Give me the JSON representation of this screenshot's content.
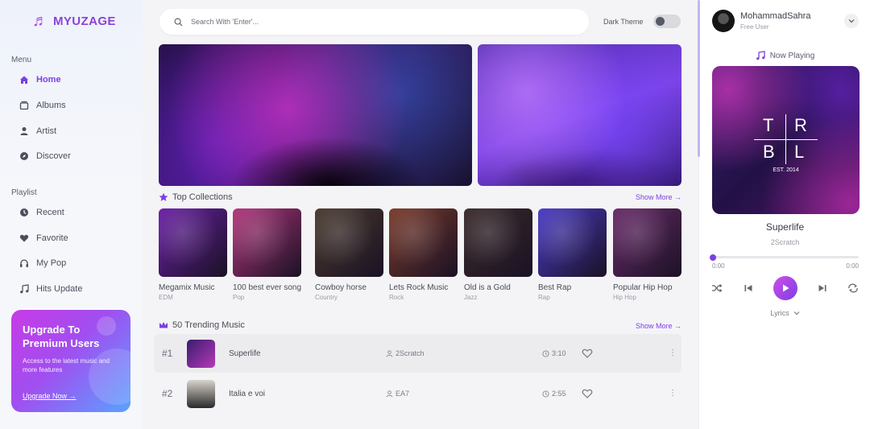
{
  "brand": {
    "name": "MYUZAGE"
  },
  "menu": {
    "label": "Menu",
    "items": [
      {
        "label": "Home",
        "icon": "home-icon",
        "active": true
      },
      {
        "label": "Albums",
        "icon": "album-icon"
      },
      {
        "label": "Artist",
        "icon": "user-icon"
      },
      {
        "label": "Discover",
        "icon": "compass-icon"
      }
    ]
  },
  "playlist": {
    "label": "Playlist",
    "items": [
      {
        "label": "Recent",
        "icon": "clock-icon"
      },
      {
        "label": "Favorite",
        "icon": "heart-icon"
      },
      {
        "label": "My Pop",
        "icon": "headphones-icon"
      },
      {
        "label": "Hits Update",
        "icon": "music-note-icon"
      }
    ]
  },
  "promo": {
    "title": "Upgrade To Premium Users",
    "subtitle": "Access to the latest music and more features",
    "link": "Upgrade Now →"
  },
  "search": {
    "placeholder": "Search With 'Enter'..."
  },
  "theme": {
    "label": "Dark Theme",
    "enabled": false
  },
  "collections": {
    "title": "Top Collections",
    "show_more": "Show More →",
    "items": [
      {
        "name": "Megamix Music",
        "genre": "EDM",
        "color": "#6a1fa6"
      },
      {
        "name": "100 best ever song",
        "genre": "Pop",
        "color": "#b2357d"
      },
      {
        "name": "Cowboy horse",
        "genre": "Country",
        "color": "#4a3a2e"
      },
      {
        "name": "Lets Rock Music",
        "genre": "Rock",
        "color": "#7a3a2a"
      },
      {
        "name": "Old is a Gold",
        "genre": "Jazz",
        "color": "#3a2a2a"
      },
      {
        "name": "Best Rap",
        "genre": "Rap",
        "color": "#4a3ac8"
      },
      {
        "name": "Popular Hip Hop",
        "genre": "Hip Hop",
        "color": "#6a2a6a"
      }
    ]
  },
  "trending": {
    "title": "50 Trending Music",
    "show_more": "Show More →",
    "tracks": [
      {
        "rank": "#1",
        "title": "Superlife",
        "artist": "2Scratch",
        "duration": "3:10"
      },
      {
        "rank": "#2",
        "title": "Italia e voi",
        "artist": "EA7",
        "duration": "2:55"
      }
    ]
  },
  "user": {
    "name": "MohammadSahra",
    "type": "Free User"
  },
  "player": {
    "label": "Now Playing",
    "title": "Superlife",
    "artist": "2Scratch",
    "current_time": "0:00",
    "total_time": "0:00",
    "progress": 0.0,
    "lyrics_label": "Lyrics",
    "art": {
      "letters": [
        "T",
        "R",
        "B",
        "L"
      ],
      "est": "EST. 2014"
    }
  },
  "colors": {
    "accent": "#7b3fe4",
    "brand": "#8a43d6"
  }
}
